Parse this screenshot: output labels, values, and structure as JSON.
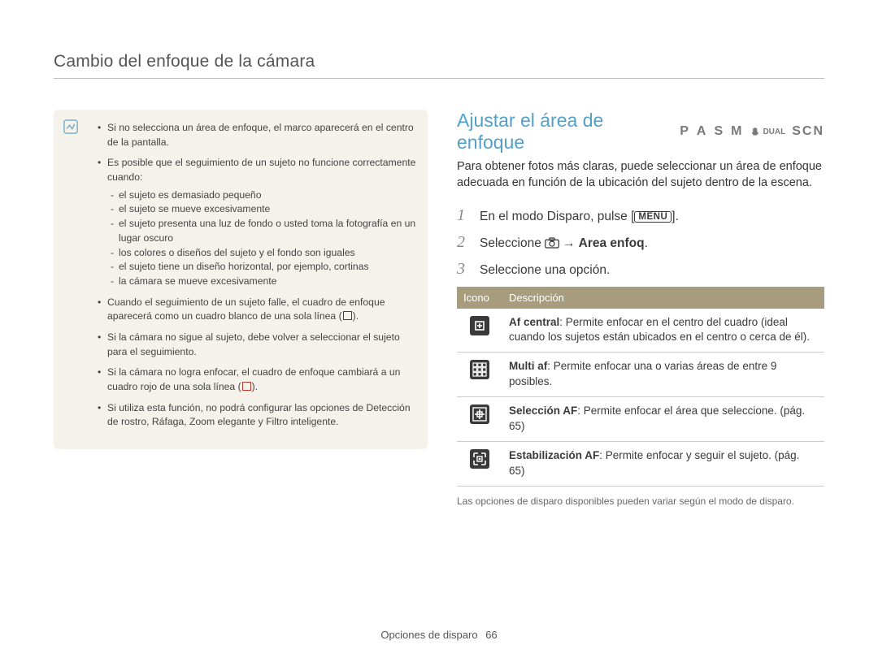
{
  "header": {
    "title": "Cambio del enfoque de la cámara"
  },
  "left": {
    "bullets": [
      {
        "text": "Si no selecciona un área de enfoque, el marco aparecerá en el centro de la pantalla."
      },
      {
        "text": "Es posible que el seguimiento de un sujeto no funcione correctamente cuando:",
        "sub": [
          "el sujeto es demasiado pequeño",
          "el sujeto se mueve excesivamente",
          "el sujeto presenta una luz de fondo o usted toma la fotografía en un lugar oscuro",
          "los colores o diseños del sujeto y el fondo son iguales",
          "el sujeto tiene un diseño horizontal, por ejemplo, cortinas",
          "la cámara se mueve excesivamente"
        ]
      },
      {
        "text_pre": "Cuando el seguimiento de un sujeto falle, el cuadro de enfoque aparecerá como un cuadro blanco de una sola línea (",
        "icon": "white",
        "text_post": ")."
      },
      {
        "text": "Si la cámara no sigue al sujeto, debe volver a seleccionar el sujeto para el seguimiento."
      },
      {
        "text_pre": "Si la cámara no logra enfocar, el cuadro de enfoque cambiará a un cuadro rojo de una sola línea (",
        "icon": "red",
        "text_post": ")."
      },
      {
        "text": "Si utiliza esta función, no podrá configurar las opciones de Detección de rostro, Ráfaga, Zoom elegante y Filtro inteligente."
      }
    ]
  },
  "right": {
    "heading": "Ajustar el área de enfoque",
    "modes": {
      "p": "P",
      "a": "A",
      "s": "S",
      "m": "M",
      "dual": "DUAL",
      "scn": "SCN"
    },
    "intro": "Para obtener fotos más claras, puede seleccionar un área de enfoque adecuada en función de la ubicación del sujeto dentro de la escena.",
    "steps": {
      "s1_pre": "En el modo Disparo, pulse [",
      "s1_menu": "MENU",
      "s1_post": "].",
      "s2_pre": "Seleccione ",
      "s2_arrow": "→",
      "s2_bold": "Area enfoq",
      "s2_post": ".",
      "s3": "Seleccione una opción."
    },
    "table": {
      "h_icon": "Icono",
      "h_desc": "Descripción",
      "rows": [
        {
          "icon": "af-central",
          "title": "Af central",
          "text": ": Permite enfocar en el centro del cuadro (ideal cuando los sujetos están ubicados en el centro o cerca de él)."
        },
        {
          "icon": "multi-af",
          "title": "Multi af",
          "text": ": Permite enfocar una o varias áreas de entre 9 posibles."
        },
        {
          "icon": "seleccion-af",
          "title": "Selección AF",
          "text": ": Permite enfocar el área que seleccione. (pág. 65)"
        },
        {
          "icon": "estabilizacion-af",
          "title": "Estabilización AF",
          "text": ": Permite enfocar y seguir el sujeto. (pág. 65)"
        }
      ]
    },
    "footnote": "Las opciones de disparo disponibles pueden variar según el modo de disparo."
  },
  "footer": {
    "section": "Opciones de disparo",
    "page": "66"
  }
}
